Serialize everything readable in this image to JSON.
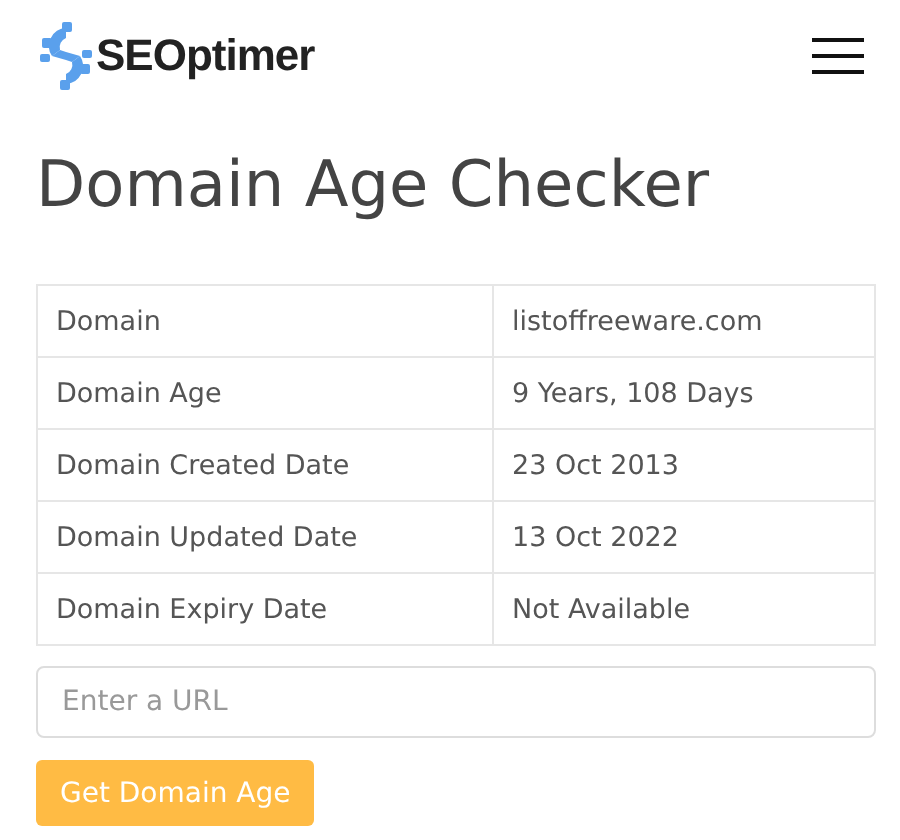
{
  "header": {
    "brand": "SEOptimer"
  },
  "title": "Domain Age Checker",
  "table": {
    "rows": [
      {
        "label": "Domain",
        "value": "listoffreeware.com"
      },
      {
        "label": "Domain Age",
        "value": "9 Years, 108 Days"
      },
      {
        "label": "Domain Created Date",
        "value": "23 Oct 2013"
      },
      {
        "label": "Domain Updated Date",
        "value": "13 Oct 2022"
      },
      {
        "label": "Domain Expiry Date",
        "value": "Not Available"
      }
    ]
  },
  "form": {
    "placeholder": "Enter a URL",
    "button": "Get Domain Age"
  }
}
